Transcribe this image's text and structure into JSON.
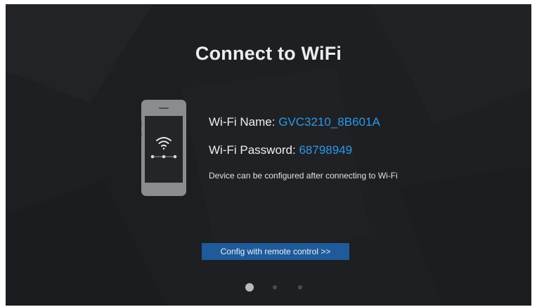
{
  "screen": {
    "title": "Connect to WiFi"
  },
  "wifi": {
    "name_label": "Wi-Fi Name:",
    "name_value": "GVC3210_8B601A",
    "password_label": "Wi-Fi Password:",
    "password_value": "68798949",
    "hint": "Device can be configured after connecting to Wi-Fi"
  },
  "actions": {
    "config_label": "Config with remote control >>"
  },
  "pager": {
    "current_page": 1,
    "total_pages": 3
  },
  "icons": {
    "phone": "smartphone-icon",
    "wifi": "wifi-icon"
  },
  "colors": {
    "background": "#1d1f22",
    "accent_text": "#2f97e8",
    "button": "#1f5b9a"
  }
}
